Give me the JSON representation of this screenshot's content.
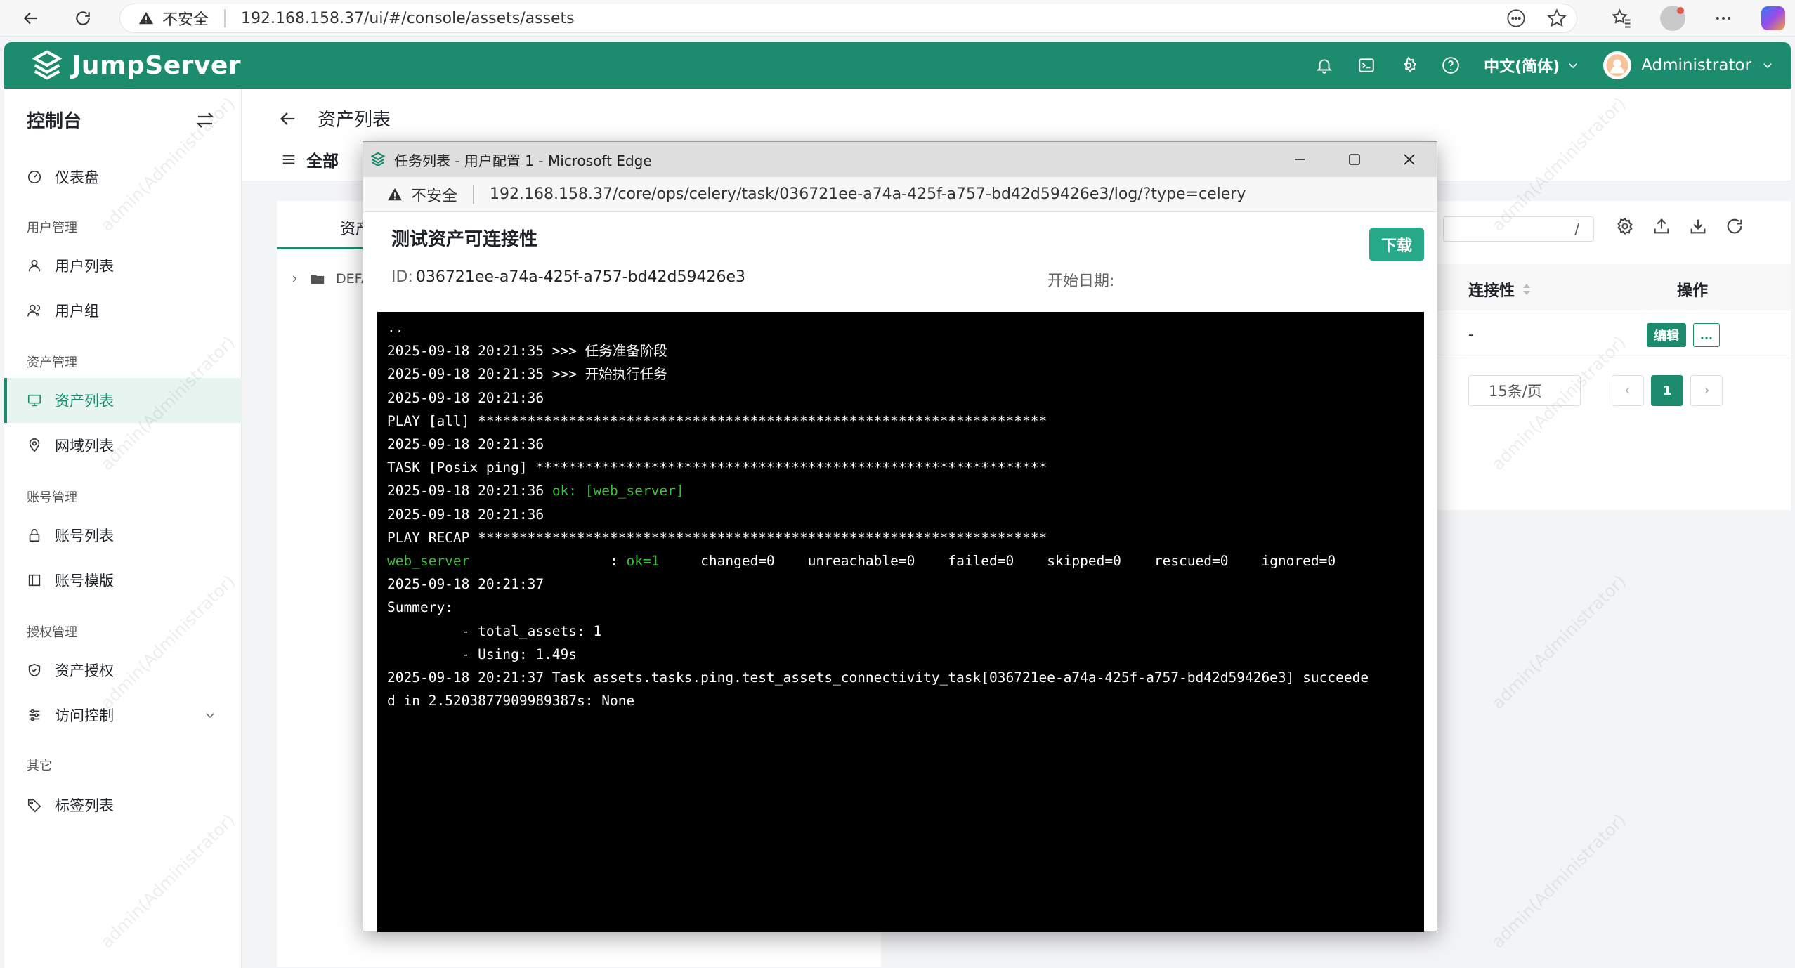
{
  "browser": {
    "security": "不安全",
    "url": "192.168.158.37/ui/#/console/assets/assets"
  },
  "header": {
    "logo": "JumpServer",
    "language": "中文(简体)",
    "user": "Administrator"
  },
  "sidebar": {
    "title": "控制台",
    "groups": {
      "users": "用户管理",
      "assets": "资产管理",
      "accounts": "账号管理",
      "perms": "授权管理",
      "other": "其它"
    },
    "items": {
      "dashboard": "仪表盘",
      "user_list": "用户列表",
      "user_group": "用户组",
      "asset_list": "资产列表",
      "domain_list": "网域列表",
      "account_list": "账号列表",
      "account_template": "账号模版",
      "asset_perm": "资产授权",
      "access_control": "访问控制",
      "label_list": "标签列表"
    }
  },
  "main": {
    "title": "资产列表",
    "tab_all": "全部",
    "left_tab": "资产",
    "tree_root": "DEFA",
    "search_slash": "/",
    "col_connectivity": "连接性",
    "col_actions": "操作",
    "row_connectivity": "-",
    "edit_label": "编辑",
    "more_label": "...",
    "page_size": "15条/页",
    "current_page": "1"
  },
  "popup": {
    "window_title": "任务列表 - 用户配置 1 - Microsoft Edge",
    "security": "不安全",
    "url": "192.168.158.37/core/ops/celery/task/036721ee-a74a-425f-a757-bd42d59426e3/log/?type=celery",
    "heading": "测试资产可连接性",
    "download": "下载",
    "id_label": "ID:",
    "id_value": "036721ee-a74a-425f-a757-bd42d59426e3",
    "start_date_label": "开始日期:",
    "log_lines": [
      {
        "t": "..",
        "green": ""
      },
      {
        "t": "2025-09-18 20:21:35 >>> 任务准备阶段",
        "green": ""
      },
      {
        "t": "2025-09-18 20:21:35 >>> 开始执行任务",
        "green": ""
      },
      {
        "t": "2025-09-18 20:21:36",
        "green": ""
      },
      {
        "t": "PLAY [all] *********************************************************************",
        "green": ""
      },
      {
        "t": "2025-09-18 20:21:36",
        "green": ""
      },
      {
        "t": "TASK [Posix ping] **************************************************************",
        "green": ""
      },
      {
        "t": "2025-09-18 20:21:36 ",
        "green": "ok: [web_server]"
      },
      {
        "t": "2025-09-18 20:21:36",
        "green": ""
      },
      {
        "t": "PLAY RECAP *********************************************************************",
        "green": ""
      },
      {
        "t": "",
        "green": "web_server",
        "mid": "                 : ",
        "green2": "ok=1",
        "rest": "     changed=0    unreachable=0    failed=0    skipped=0    rescued=0    ignored=0"
      },
      {
        "t": "2025-09-18 20:21:37",
        "green": ""
      },
      {
        "t": "Summery:",
        "green": ""
      },
      {
        "t": "         - total_assets: 1",
        "green": ""
      },
      {
        "t": "         - Using: 1.49s",
        "green": ""
      },
      {
        "t": "2025-09-18 20:21:37 Task assets.tasks.ping.test_assets_connectivity_task[036721ee-a74a-425f-a757-bd42d59426e3] succeede",
        "green": ""
      },
      {
        "t": "d in 2.5203877909989387s: None",
        "green": ""
      }
    ]
  },
  "watermark": "admin(Administrator)"
}
